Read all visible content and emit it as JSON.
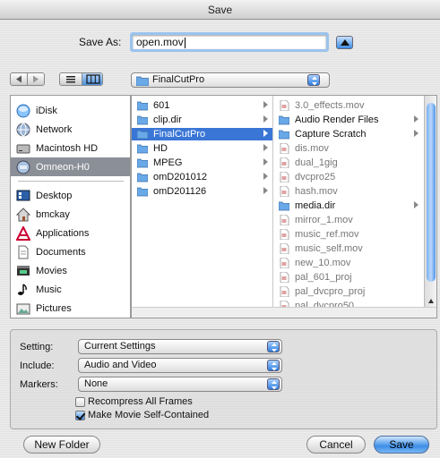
{
  "window": {
    "title": "Save"
  },
  "save_as": {
    "label": "Save As:",
    "value": "open.mov"
  },
  "location_popup": {
    "value": "FinalCutPro"
  },
  "sidebar": {
    "items": [
      {
        "label": "iDisk",
        "icon": "idisk-icon"
      },
      {
        "label": "Network",
        "icon": "network-globe-icon"
      },
      {
        "label": "Macintosh HD",
        "icon": "hard-drive-icon"
      },
      {
        "label": "Omneon-H0",
        "icon": "network-volume-icon",
        "selected": true
      },
      {
        "label": "Desktop",
        "icon": "desktop-icon"
      },
      {
        "label": "bmckay",
        "icon": "home-icon"
      },
      {
        "label": "Applications",
        "icon": "applications-icon"
      },
      {
        "label": "Documents",
        "icon": "documents-icon"
      },
      {
        "label": "Movies",
        "icon": "movies-icon"
      },
      {
        "label": "Music",
        "icon": "music-icon"
      },
      {
        "label": "Pictures",
        "icon": "pictures-icon"
      }
    ]
  },
  "column1": {
    "items": [
      {
        "label": "601",
        "type": "folder"
      },
      {
        "label": "clip.dir",
        "type": "folder"
      },
      {
        "label": "FinalCutPro",
        "type": "folder",
        "selected": true
      },
      {
        "label": "HD",
        "type": "folder"
      },
      {
        "label": "MPEG",
        "type": "folder"
      },
      {
        "label": "omD201012",
        "type": "folder"
      },
      {
        "label": "omD201126",
        "type": "folder"
      }
    ]
  },
  "column2": {
    "items": [
      {
        "label": "3.0_effects.mov",
        "type": "file"
      },
      {
        "label": "Audio Render Files",
        "type": "folder"
      },
      {
        "label": "Capture Scratch",
        "type": "folder"
      },
      {
        "label": "dis.mov",
        "type": "file"
      },
      {
        "label": "dual_1gig",
        "type": "file"
      },
      {
        "label": "dvcpro25",
        "type": "file"
      },
      {
        "label": "hash.mov",
        "type": "file"
      },
      {
        "label": "media.dir",
        "type": "folder"
      },
      {
        "label": "mirror_1.mov",
        "type": "file"
      },
      {
        "label": "music_ref.mov",
        "type": "file"
      },
      {
        "label": "music_self.mov",
        "type": "file"
      },
      {
        "label": "new_10.mov",
        "type": "file"
      },
      {
        "label": "pal_601_proj",
        "type": "file"
      },
      {
        "label": "pal_dvcpro_proj",
        "type": "file"
      },
      {
        "label": "pal_dvcpro50",
        "type": "file"
      }
    ]
  },
  "options": {
    "setting_label": "Setting:",
    "setting_value": "Current Settings",
    "include_label": "Include:",
    "include_value": "Audio and Video",
    "markers_label": "Markers:",
    "markers_value": "None",
    "recompress_label": "Recompress All Frames",
    "recompress_checked": false,
    "self_contained_label": "Make Movie Self-Contained",
    "self_contained_checked": true
  },
  "buttons": {
    "new_folder": "New Folder",
    "cancel": "Cancel",
    "save": "Save"
  },
  "colors": {
    "selection": "#3a76d6",
    "sidebar_selection": "#8b8f97",
    "folder": "#6aa9e8",
    "default_button": "#3d8ee6"
  }
}
